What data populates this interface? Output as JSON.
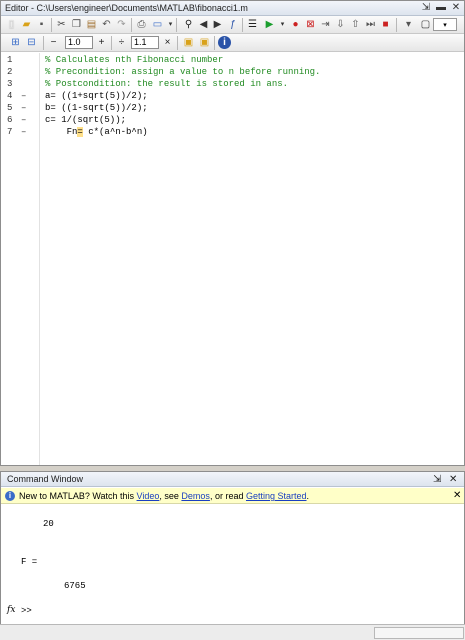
{
  "editor": {
    "title": "Editor - C:\\Users\\engineer\\Documents\\MATLAB\\fibonacci1.m",
    "cell_toolbar": {
      "minus_label": "−",
      "value1": "1.0",
      "plus_label": "+",
      "divide_label": "÷",
      "value2": "1.1",
      "times_label": "×"
    },
    "lines": [
      {
        "num": "1",
        "dash": "",
        "text": "% Calculates nth Fibonacci number",
        "type": "comment"
      },
      {
        "num": "2",
        "dash": "",
        "text": "% Precondition: assign a value to n before running.",
        "type": "comment"
      },
      {
        "num": "3",
        "dash": "",
        "text": "% Postcondition: the result is stored in ans.",
        "type": "comment"
      },
      {
        "num": "4",
        "dash": "–",
        "text": "a= ((1+sqrt(5))/2);",
        "type": "code"
      },
      {
        "num": "5",
        "dash": "–",
        "text": "b= ((1-sqrt(5))/2);",
        "type": "code"
      },
      {
        "num": "6",
        "dash": "–",
        "text": "c= 1/(sqrt(5));",
        "type": "code"
      },
      {
        "num": "7",
        "dash": "–",
        "text_pre": "    Fn",
        "text_hl": "=",
        "text_post": " c*(a^n-b^n)",
        "type": "code"
      }
    ]
  },
  "command_window": {
    "title": "Command Window",
    "info": {
      "prefix": "New to MATLAB? Watch this ",
      "video": "Video",
      "mid1": ", see ",
      "demos": "Demos",
      "mid2": ", or read ",
      "getting_started": "Getting Started",
      "suffix": "."
    },
    "output_value1": "20",
    "output_var": "F =",
    "output_value2": "6765",
    "prompt_icon": "fx",
    "prompt": ">>"
  },
  "icons": [
    "new-file-icon",
    "open-folder-icon",
    "save-icon",
    "cut-icon",
    "copy-icon",
    "paste-icon",
    "undo-icon",
    "redo-icon",
    "print-icon",
    "find-icon",
    "back-icon",
    "forward-icon",
    "function-icon",
    "run-icon",
    "breakpoint-icon",
    "stop-icon",
    "window-layout-icon",
    "help-icon"
  ]
}
